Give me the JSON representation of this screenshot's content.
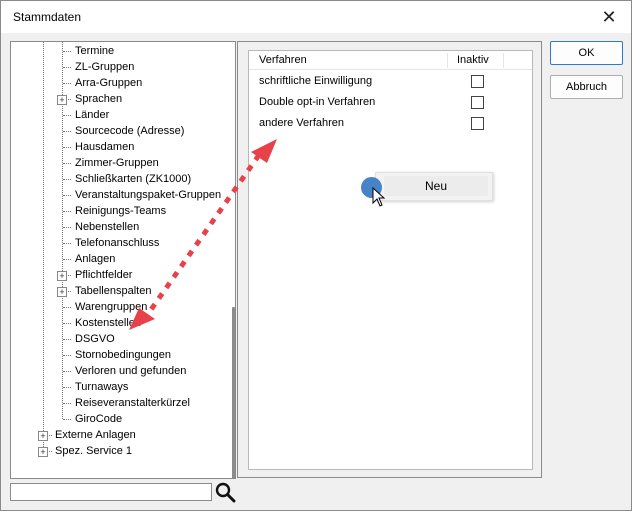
{
  "window": {
    "title": "Stammdaten",
    "close_label": "✕"
  },
  "tree": {
    "items": [
      {
        "label": "Termine",
        "expandable": false
      },
      {
        "label": "ZL-Gruppen",
        "expandable": false
      },
      {
        "label": "Arra-Gruppen",
        "expandable": false
      },
      {
        "label": "Sprachen",
        "expandable": true
      },
      {
        "label": "Länder",
        "expandable": false
      },
      {
        "label": "Sourcecode (Adresse)",
        "expandable": false
      },
      {
        "label": "Hausdamen",
        "expandable": false
      },
      {
        "label": "Zimmer-Gruppen",
        "expandable": false
      },
      {
        "label": "Schließkarten (ZK1000)",
        "expandable": false
      },
      {
        "label": "Veranstaltungspaket-Gruppen",
        "expandable": false
      },
      {
        "label": "Reinigungs-Teams",
        "expandable": false
      },
      {
        "label": "Nebenstellen",
        "expandable": false
      },
      {
        "label": "Telefonanschluss",
        "expandable": false
      },
      {
        "label": "Anlagen",
        "expandable": false
      },
      {
        "label": "Pflichtfelder",
        "expandable": true
      },
      {
        "label": "Tabellenspalten",
        "expandable": true
      },
      {
        "label": "Warengruppen",
        "expandable": false
      },
      {
        "label": "Kostenstellen",
        "expandable": false
      },
      {
        "label": "DSGVO",
        "expandable": false
      },
      {
        "label": "Stornobedingungen",
        "expandable": false
      },
      {
        "label": "Verloren und gefunden",
        "expandable": false
      },
      {
        "label": "Turnaways",
        "expandable": false
      },
      {
        "label": "Reiseveranstalterkürzel",
        "expandable": false
      },
      {
        "label": "GiroCode",
        "expandable": false
      }
    ],
    "root_items": [
      {
        "label": "Externe Anlagen",
        "expandable": true
      },
      {
        "label": "Spez. Service 1",
        "expandable": true
      }
    ]
  },
  "search": {
    "value": "",
    "icon": "search-icon"
  },
  "grid": {
    "columns": [
      "Verfahren",
      "Inaktiv"
    ],
    "rows": [
      {
        "label": "schriftliche Einwilligung",
        "inactive": false
      },
      {
        "label": "Double opt-in Verfahren",
        "inactive": false
      },
      {
        "label": "andere Verfahren",
        "inactive": false
      }
    ]
  },
  "buttons": {
    "ok": "OK",
    "cancel": "Abbruch"
  },
  "context_menu": {
    "items": [
      "Neu"
    ]
  },
  "colors": {
    "accent": "#2b7bc8",
    "annotation_arrow": "#e8414a",
    "cursor_dot": "#3d7cc4"
  }
}
